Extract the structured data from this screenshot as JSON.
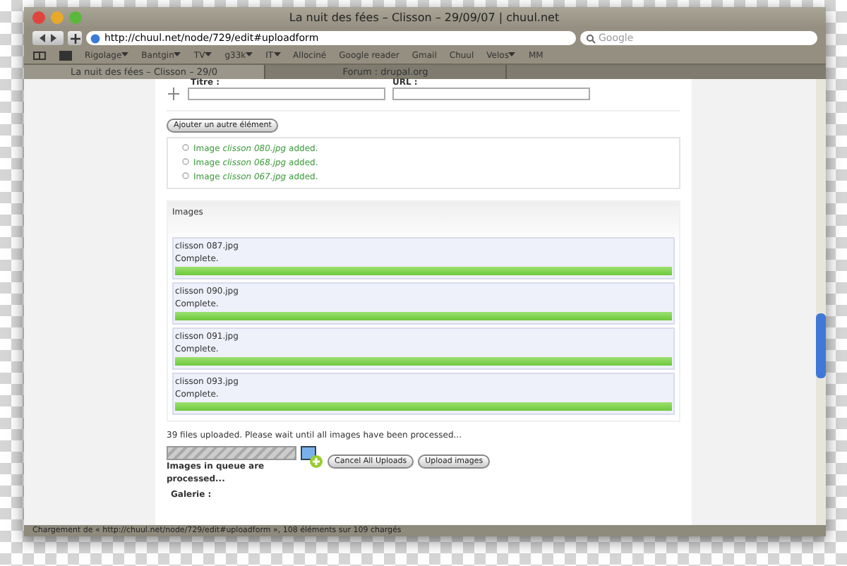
{
  "window": {
    "title": "La nuit des fées – Clisson – 29/09/07 | chuul.net"
  },
  "toolbar": {
    "url": "http://chuul.net/node/729/edit#uploadform",
    "search_placeholder": "Google"
  },
  "bookmarks": [
    {
      "label": "Rigolage",
      "menu": true
    },
    {
      "label": "Bantgin",
      "menu": true
    },
    {
      "label": "TV",
      "menu": true
    },
    {
      "label": "g33k",
      "menu": true
    },
    {
      "label": "IT",
      "menu": true
    },
    {
      "label": "Allociné",
      "menu": false
    },
    {
      "label": "Google reader",
      "menu": false
    },
    {
      "label": "Gmail",
      "menu": false
    },
    {
      "label": "Chuul",
      "menu": false
    },
    {
      "label": "Velos",
      "menu": true
    },
    {
      "label": "MM",
      "menu": false
    }
  ],
  "tabs": [
    {
      "label": "La nuit des fées – Clisson – 29/0",
      "selected": true
    },
    {
      "label": "Forum : drupal.org",
      "selected": false
    }
  ],
  "form": {
    "title_label": "Titre :",
    "url_label": "URL :",
    "add_button": "Ajouter un autre élément",
    "messages": [
      {
        "before": "Image ",
        "file": "clisson 080.jpg",
        "after": " added."
      },
      {
        "before": "Image ",
        "file": "clisson 068.jpg",
        "after": " added."
      },
      {
        "before": "Image ",
        "file": "clisson 067.jpg",
        "after": " added."
      }
    ],
    "images_legend": "Images",
    "uploads": [
      {
        "file": "clisson 087.jpg",
        "status": "Complete.",
        "level": 1
      },
      {
        "file": "clisson 090.jpg",
        "status": "Complete.",
        "level": 1
      },
      {
        "file": "clisson 091.jpg",
        "status": "Complete.",
        "level": 1
      },
      {
        "file": "clisson 093.jpg",
        "status": "Complete.",
        "level": 1
      }
    ],
    "summary": "39 files uploaded. Please wait until all images have been processed...",
    "queue_bar": {
      "level": 1
    },
    "queue_text": "Images in queue are processed...",
    "cancel_button": "Cancel All Uploads",
    "upload_button": "Upload images",
    "gallery_label": "Galerie :"
  },
  "status_bar": "Chargement de « http://chuul.net/node/729/edit#uploadform », 108 éléments sur 109 chargés"
}
